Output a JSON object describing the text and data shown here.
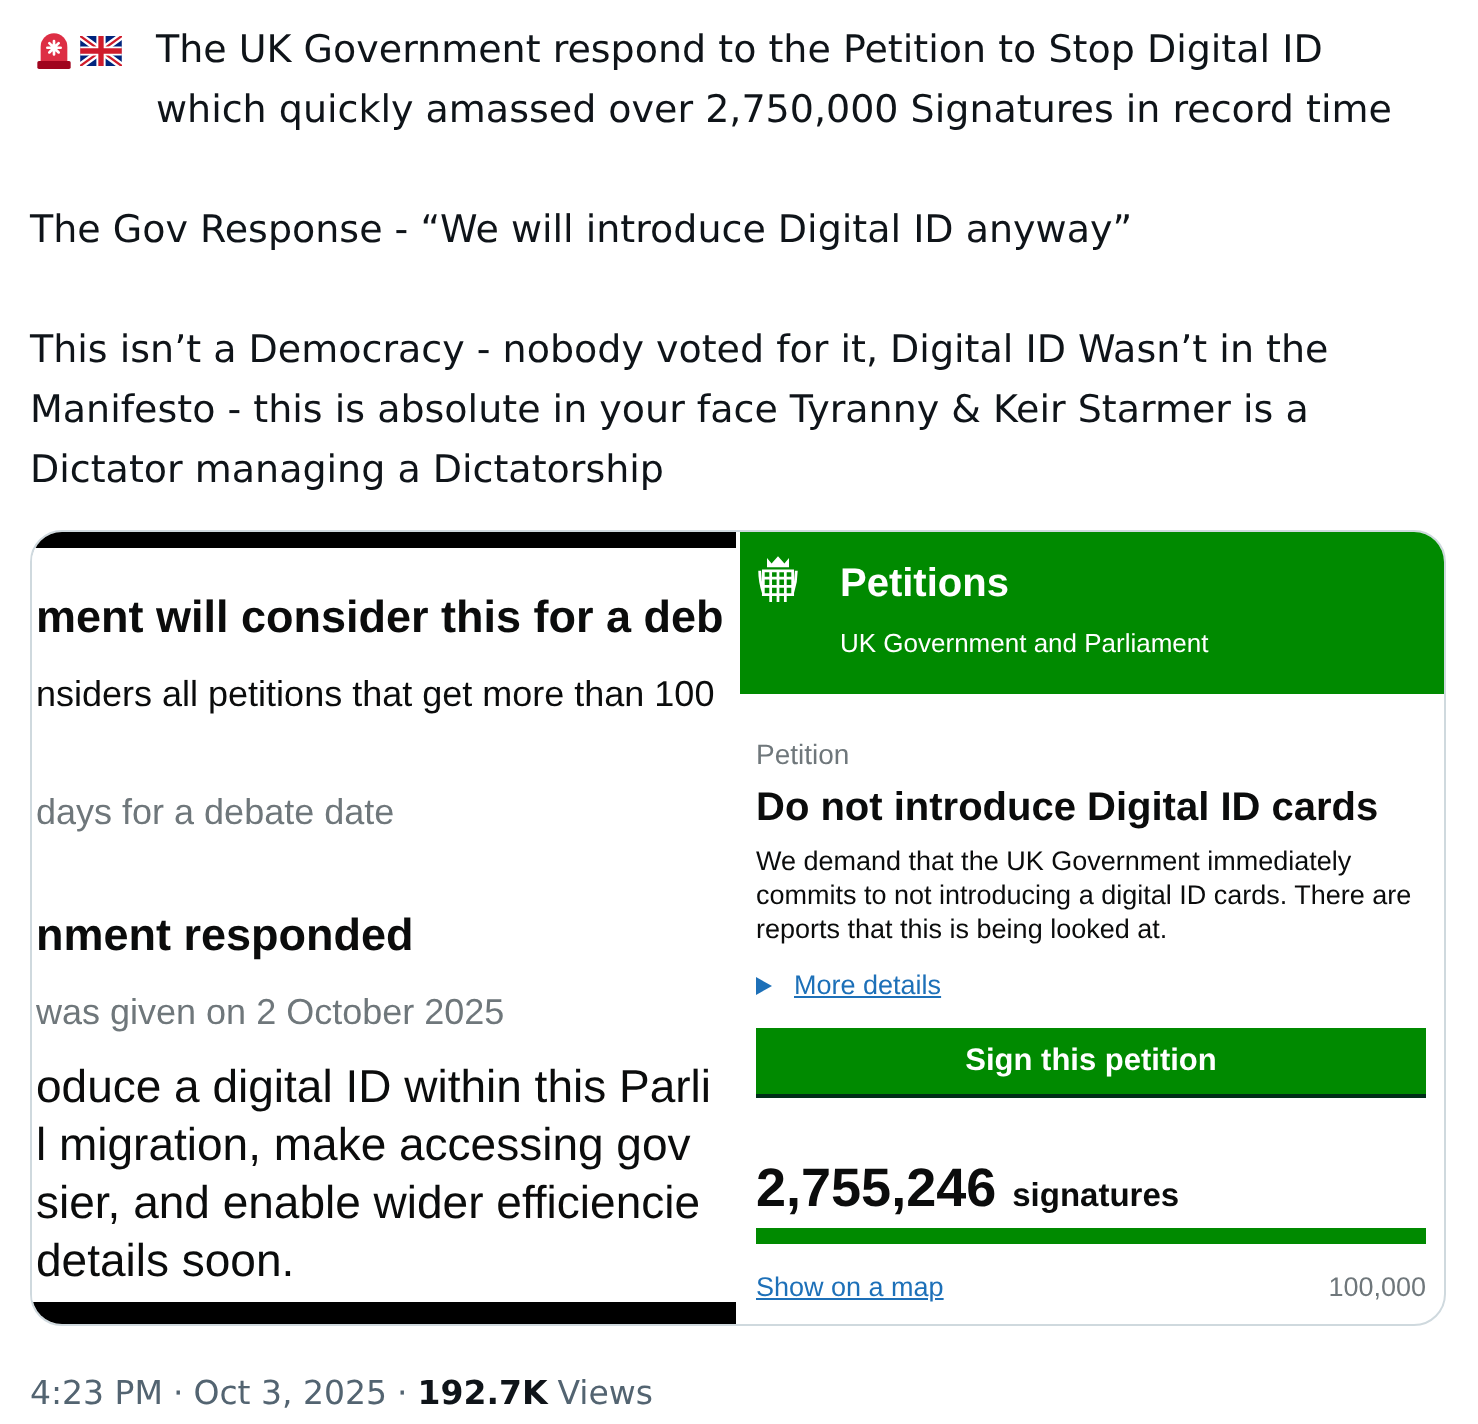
{
  "tweet": {
    "paragraphs": [
      "The UK Government respond to the Petition to Stop Digital ID which quickly amassed over 2,750,000 Signatures in record time",
      "The Gov Response - “We will introduce Digital ID anyway”",
      "This isn’t a Democracy - nobody voted for it, Digital ID Wasn’t in the Manifesto - this is absolute in your face Tyranny & Keir Starmer is a Dictator managing a Dictatorship"
    ]
  },
  "media": {
    "screenshot_crop": {
      "lines": [
        {
          "kind": "heading",
          "text": "ment will consider this for a deb"
        },
        {
          "kind": "body",
          "text": "nsiders all petitions that get more than 100"
        },
        {
          "kind": "muted",
          "text": "days for a debate date"
        },
        {
          "kind": "heading",
          "text": "nment responded"
        },
        {
          "kind": "muted",
          "text": "was given on 2 October 2025"
        },
        {
          "kind": "large",
          "text": "oduce a digital ID within this Parli"
        },
        {
          "kind": "large",
          "text": "l migration, make accessing gov"
        },
        {
          "kind": "large",
          "text": "sier, and enable wider efficiencie"
        },
        {
          "kind": "large",
          "text": "details soon."
        }
      ]
    },
    "petition_page": {
      "site_title": "Petitions",
      "site_subtitle": "UK Government and Parliament",
      "label": "Petition",
      "title": "Do not introduce Digital ID cards",
      "description": "We demand that the UK Government immediately commits to not introducing a digital ID cards. There are reports that this is being looked at.",
      "more_details": "More details",
      "sign_button": "Sign this petition",
      "signature_count": "2,755,246",
      "signature_unit": "signatures",
      "progress": {
        "level": 1
      },
      "map_link": "Show on a map",
      "threshold": "100,000"
    }
  },
  "footer": {
    "items": [
      {
        "kind": "time",
        "text": "4:23 PM"
      },
      {
        "kind": "separator",
        "text": "·"
      },
      {
        "kind": "date",
        "text": "Oct 3, 2025"
      },
      {
        "kind": "separator",
        "text": "·"
      },
      {
        "kind": "count",
        "text": "192.7K"
      },
      {
        "kind": "label",
        "text": "Views"
      }
    ]
  }
}
